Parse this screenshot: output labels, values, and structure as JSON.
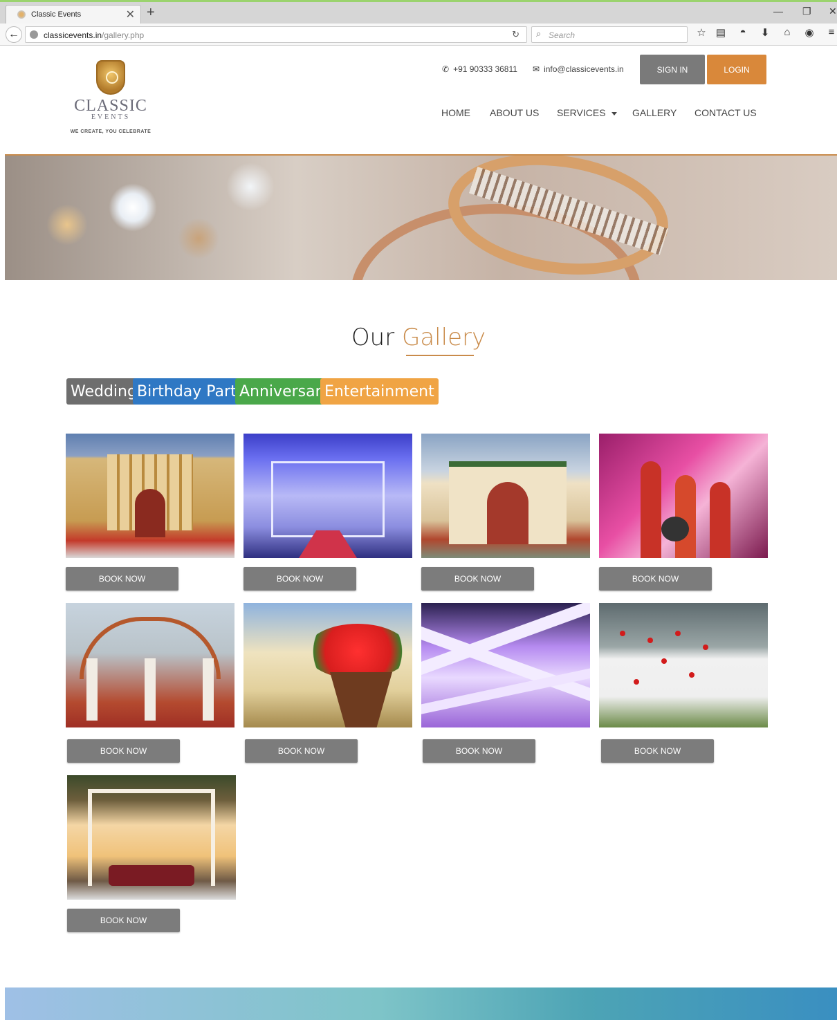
{
  "browser": {
    "tab_title": "Classic Events",
    "url_host": "classicevents.in",
    "url_path": "/gallery.php",
    "search_placeholder": "Search"
  },
  "header": {
    "brand": "CLASSIC",
    "brand_sub": "EVENTS",
    "tagline": "WE CREATE, YOU CELEBRATE",
    "phone": "+91 90333 36811",
    "email": "info@classicevents.in",
    "signin_label": "SIGN IN",
    "login_label": "LOGIN",
    "nav": [
      "HOME",
      "ABOUT US",
      "SERVICES",
      "GALLERY",
      "CONTACT US"
    ],
    "accent_color": "#c98b4a"
  },
  "gallery": {
    "title_prefix": "Our",
    "title_accent": "Gallery",
    "filters": [
      {
        "label": "Wedding",
        "color": "#6e6e6e"
      },
      {
        "label": "Birthday Party",
        "color": "#2f78c4"
      },
      {
        "label": "Anniversary",
        "color": "#4aa84a"
      },
      {
        "label": "Entertainment",
        "color": "#f0a444"
      }
    ],
    "book_label": "BOOK NOW",
    "items": [
      {
        "image": "palace-gate-decor"
      },
      {
        "image": "blue-lit-walkway"
      },
      {
        "image": "fort-entrance-decor"
      },
      {
        "image": "dhol-players"
      },
      {
        "image": "mandap-canopy"
      },
      {
        "image": "flower-arrangement"
      },
      {
        "image": "purple-fabric-ceiling"
      },
      {
        "image": "white-wall-red-flowers"
      },
      {
        "image": "lit-drape-lounge"
      }
    ]
  }
}
